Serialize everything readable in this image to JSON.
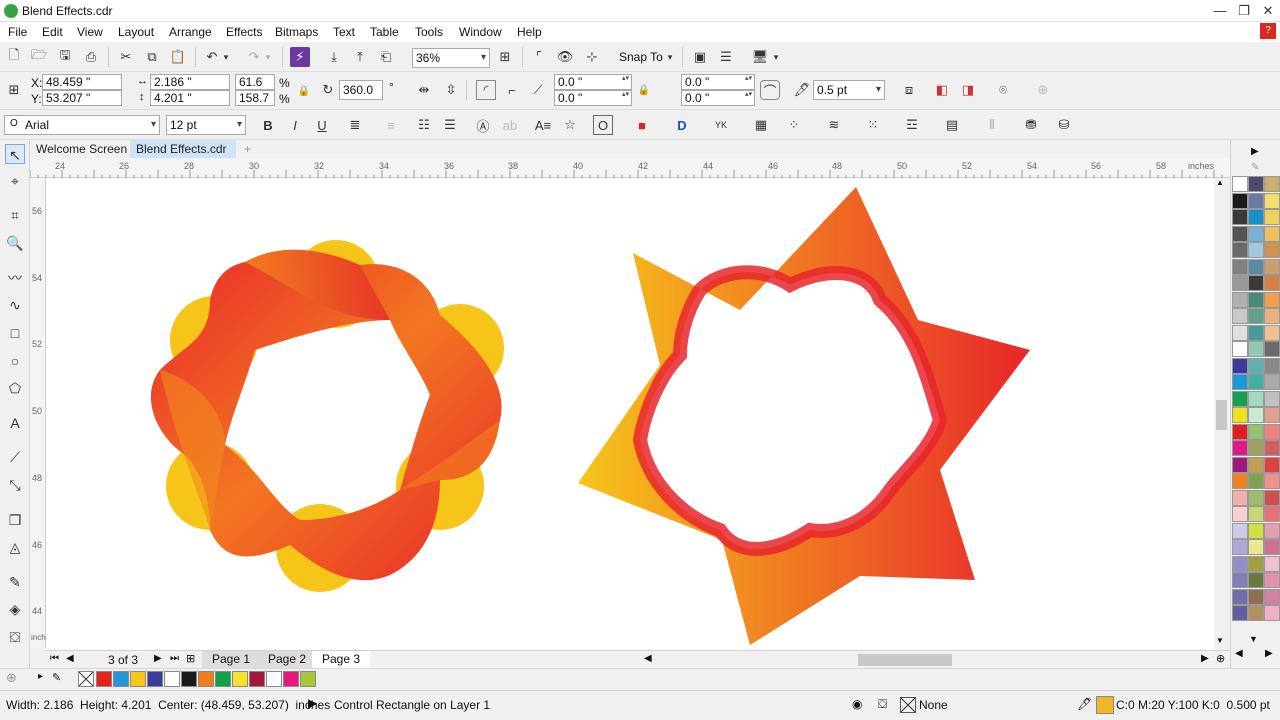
{
  "window": {
    "title": "Blend Effects.cdr"
  },
  "menu": [
    "File",
    "Edit",
    "View",
    "Layout",
    "Arrange",
    "Effects",
    "Bitmaps",
    "Text",
    "Table",
    "Tools",
    "Window",
    "Help"
  ],
  "toolbar1": {
    "zoom": "36%",
    "snap_to": "Snap To"
  },
  "propbar": {
    "x_label": "X:",
    "x": "48.459 \"",
    "y_label": "Y:",
    "y": "53.207 \"",
    "w": "2.186 \"",
    "h": "4.201 \"",
    "sx": "61.6",
    "sy": "158.7",
    "pct": "%",
    "angle": "360.0",
    "deg": "°",
    "c1": "0.0 \"",
    "c2": "0.0 \"",
    "c3": "0.0 \"",
    "c4": "0.0 \"",
    "outline": "0.5 pt"
  },
  "textbar": {
    "font": "Arial",
    "size": "12 pt"
  },
  "tabs": [
    "Welcome Screen",
    "Blend Effects.cdr"
  ],
  "ruler": {
    "h_ticks": [
      "24",
      "26",
      "28",
      "30",
      "32",
      "34",
      "36",
      "38",
      "40",
      "42",
      "44",
      "46",
      "48",
      "50",
      "52",
      "54",
      "56",
      "58"
    ],
    "h_unit": "inches",
    "v_ticks": [
      "56",
      "54",
      "52",
      "50",
      "48",
      "46",
      "44"
    ],
    "v_unit": "inches"
  },
  "pages": {
    "counter": "3 of 3",
    "tabs": [
      "Page 1",
      "Page 2",
      "Page 3"
    ]
  },
  "status": {
    "size": "Width: 2.186  Height: 4.201  Center: (48.459, 53.207)  inches",
    "layer": "Control Rectangle on Layer 1",
    "fill": "None",
    "color": "C:0 M:20 Y:100 K:0  0.500 pt"
  },
  "colors": {
    "red": "#e8262b",
    "orange": "#f27621",
    "yellow": "#f7c51a",
    "accent": "#f2b824"
  },
  "doc_swatches": [
    "#e2231a",
    "#1f98d5",
    "#f5c91a",
    "#3c3c9a",
    "#ffffff",
    "#1a1a1a",
    "#ef7f1a",
    "#14a04a",
    "#f5e32a",
    "#a3183c",
    "#ffffff",
    "#e6187c",
    "#a8c838"
  ],
  "palette": [
    "#ffffff",
    "#4a4a6a",
    "#c8b070",
    "#1a1a1a",
    "#6a7aa0",
    "#f0e070",
    "#3a3a3a",
    "#1a90c8",
    "#f0d060",
    "#555555",
    "#7ab0d8",
    "#f0c060",
    "#6a6a6a",
    "#a0c8e0",
    "#d09050",
    "#808080",
    "#5a8aa0",
    "#c8a070",
    "#999999",
    "#3a3a3a",
    "#d88040",
    "#b0b0b0",
    "#4a8a7a",
    "#f0a050",
    "#c8c8c8",
    "#60a090",
    "#e8b080",
    "#e0e0e0",
    "#4a9a9a",
    "#f0c090",
    "#ffffff",
    "#90c8b0",
    "#6a6a6a",
    "#3a3aa0",
    "#60b0b0",
    "#888888",
    "#1a98d8",
    "#40b0a0",
    "#aaaaaa",
    "#18a050",
    "#a0d8c0",
    "#c0c0c0",
    "#f0e020",
    "#c8e8d0",
    "#e0a090",
    "#e02020",
    "#90c070",
    "#f08080",
    "#e0188a",
    "#a0a060",
    "#d06060",
    "#a0187a",
    "#c0a050",
    "#e04040",
    "#f08020",
    "#80a050",
    "#f09090",
    "#f0b0b0",
    "#a0b870",
    "#d05050",
    "#f8d0d0",
    "#c8d870",
    "#e87070",
    "#d0c8e8",
    "#d0e040",
    "#e0a0b0",
    "#b0a8d8",
    "#e8e890",
    "#d07090",
    "#9090c8",
    "#a0a040",
    "#f0c0d0",
    "#8080b8",
    "#6a7a40",
    "#e090b0",
    "#7070a8",
    "#907050",
    "#d080a0",
    "#6060a0",
    "#b09060",
    "#f0b0c8"
  ]
}
